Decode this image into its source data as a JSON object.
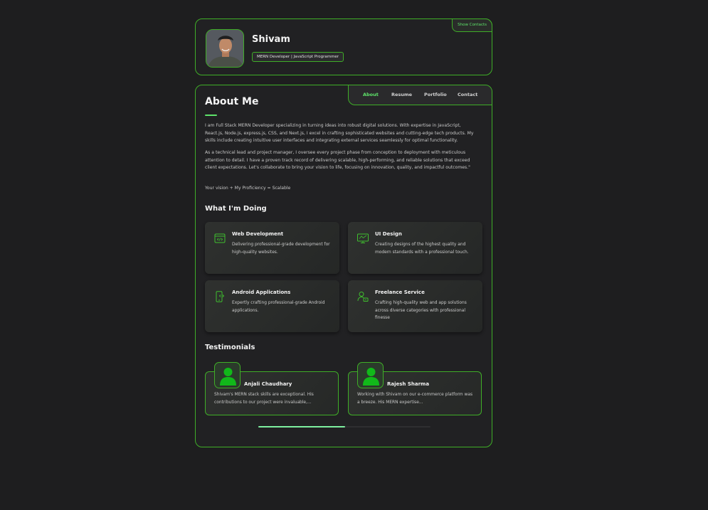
{
  "profile": {
    "name": "Shivam",
    "title": "MERN Developer | JavaScript Programmer",
    "show_contacts": "Show Contacts"
  },
  "nav": {
    "items": [
      "About",
      "Resume",
      "Portfolio",
      "Contact"
    ],
    "active": "About"
  },
  "about": {
    "title": "About Me",
    "paragraphs": [
      "I am Full Stack MERN Developer specializing in turning ideas into robust digital solutions. With expertise in JavaScript, React.js, Node.js, express.js, CSS, and Next.js, I excel in crafting sophisticated websites and cutting-edge tech products. My skills include creating intuitive user interfaces and integrating external services seamlessly for optimal functionality.",
      "As a technical lead and project manager, I oversee every project phase from conception to deployment with meticulous attention to detail. I have a proven track record of delivering scalable, high-performing, and reliable solutions that exceed client expectations. Let's collaborate to bring your vision to life, focusing on innovation, quality, and impactful outcomes.\"",
      "Your vision + My Proficiency = Scalable"
    ]
  },
  "doing": {
    "title": "What I'm Doing",
    "services": [
      {
        "title": "Web Development",
        "text": "Delivering professional-grade development for high-quality websites.",
        "icon": "code-window-icon"
      },
      {
        "title": "UI Design",
        "text": "Creating designs of the highest quality and modern standards with a professional touch.",
        "icon": "monitor-design-icon"
      },
      {
        "title": "Android Applications",
        "text": "Expertly crafting professional-grade Android applications.",
        "icon": "mobile-code-icon"
      },
      {
        "title": "Freelance Service",
        "text": "Crafting high-quality web and app solutions across diverse categories with professional finesse",
        "icon": "freelancer-icon"
      }
    ]
  },
  "testimonials": {
    "title": "Testimonials",
    "items": [
      {
        "name": "Anjali Chaudhary",
        "text": "Shivam's MERN stack skills are exceptional. His contributions to our project were invaluable,..."
      },
      {
        "name": "Rajesh Sharma",
        "text": "Working with Shivam on our e-commerce platform was a breeze. His MERN expertise..."
      }
    ]
  },
  "colors": {
    "accent": "#5ee36a",
    "border": "#3fae27",
    "background": "#1e1e1f",
    "card": "#212123"
  }
}
